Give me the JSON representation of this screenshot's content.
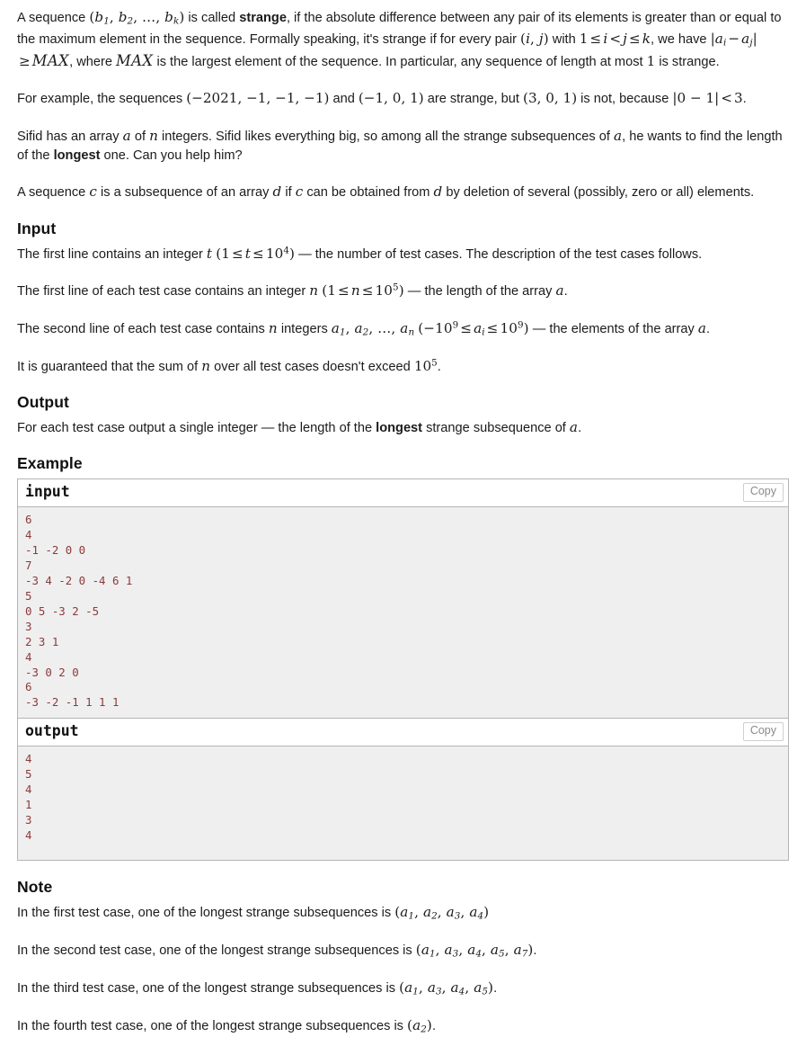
{
  "problem": {
    "definition": {
      "line1_pre": "A sequence ",
      "seq_b": "(b₁, b₂, …, b_k)",
      "line1_mid": " is called ",
      "strange_bold": "strange",
      "line1_post": ", if the absolute difference between any pair of its elements is greater than or equal to the maximum element in the sequence. Formally speaking, it's strange if for every pair ",
      "pair_ij": "(i, j)",
      "with_word": " with ",
      "range_ij": "1 ≤ i < j ≤ k",
      "we_have": ", we have ",
      "abs_diff": "|aᵢ − aⱼ|",
      "geq": " ≥ ",
      "max_sym": "MAX",
      "where_word": ", where ",
      "max_sym2": "MAX",
      "tail": " is the largest element of the sequence. In particular, any sequence of length at most ",
      "one": "1",
      "tail2": " is strange."
    },
    "example_para": {
      "pre": "For example, the sequences ",
      "seq1": "(−2021, −1, −1, −1)",
      "and_word": " and ",
      "seq2": "(−1, 0, 1)",
      "mid": " are strange, but ",
      "seq3": "(3, 0, 1)",
      "post": " is not, because ",
      "ineq": "|0 − 1| < 3",
      "end": "."
    },
    "sifid_para": {
      "pre": "Sifid has an array ",
      "a": "a",
      "mid1": " of ",
      "n": "n",
      "mid2": " integers. Sifid likes everything big, so among all the strange subsequences of ",
      "a2": "a",
      "mid3": ", he wants to find the length of the ",
      "longest_bold": "longest",
      "post": " one. Can you help him?"
    },
    "subsequence_para": {
      "pre": "A sequence ",
      "c": "c",
      "mid1": " is a subsequence of an array ",
      "d": "d",
      "mid2": " if ",
      "c2": "c",
      "mid3": " can be obtained from ",
      "d2": "d",
      "post": " by deletion of several (possibly, zero or all) elements."
    }
  },
  "input_section": {
    "heading": "Input",
    "p1": {
      "pre": "The first line contains an integer ",
      "t": "t",
      "range": "(1 ≤ t ≤ 10⁴)",
      "post": " — the number of test cases. The description of the test cases follows."
    },
    "p2": {
      "pre": "The first line of each test case contains an integer ",
      "n": "n",
      "range": "(1 ≤ n ≤ 10⁵)",
      "post": " — the length of the array ",
      "a": "a",
      "end": "."
    },
    "p3": {
      "pre": "The second line of each test case contains ",
      "n": "n",
      "mid": " integers ",
      "elements": "a₁, a₂, …, a_n",
      "range": "(−10⁹ ≤ aᵢ ≤ 10⁹)",
      "post": " — the elements of the array ",
      "a": "a",
      "end": "."
    },
    "p4": {
      "pre": "It is guaranteed that the sum of ",
      "n": "n",
      "mid": " over all test cases doesn't exceed ",
      "bound": "10⁵",
      "end": "."
    }
  },
  "output_section": {
    "heading": "Output",
    "p1": {
      "pre": "For each test case output a single integer — the length of the ",
      "longest_bold": "longest",
      "post": " strange subsequence of ",
      "a": "a",
      "end": "."
    }
  },
  "example_section": {
    "heading": "Example",
    "input_label": "input",
    "output_label": "output",
    "copy_label": "Copy",
    "input_data": "6\n4\n-1 -2 0 0\n7\n-3 4 -2 0 -4 6 1\n5\n0 5 -3 2 -5\n3\n2 3 1\n4\n-3 0 2 0\n6\n-3 -2 -1 1 1 1",
    "output_data": "4\n5\n4\n1\n3\n4",
    "test_cases": [
      {
        "n": 4,
        "array": [
          -1,
          -2,
          0,
          0
        ],
        "answer": 4
      },
      {
        "n": 7,
        "array": [
          -3,
          4,
          -2,
          0,
          -4,
          6,
          1
        ],
        "answer": 5
      },
      {
        "n": 5,
        "array": [
          0,
          5,
          -3,
          2,
          -5
        ],
        "answer": 4
      },
      {
        "n": 3,
        "array": [
          2,
          3,
          1
        ],
        "answer": 1
      },
      {
        "n": 4,
        "array": [
          -3,
          0,
          2,
          0
        ],
        "answer": 3
      },
      {
        "n": 6,
        "array": [
          -3,
          -2,
          -1,
          1,
          1,
          1
        ],
        "answer": 4
      }
    ],
    "t": 6
  },
  "note_section": {
    "heading": "Note",
    "notes": [
      {
        "pre": "In the first test case, one of the longest strange subsequences is ",
        "seq": "(a₁, a₂, a₃, a₄)",
        "end": ""
      },
      {
        "pre": "In the second test case, one of the longest strange subsequences is ",
        "seq": "(a₁, a₃, a₄, a₅, a₇)",
        "end": "."
      },
      {
        "pre": "In the third test case, one of the longest strange subsequences is ",
        "seq": "(a₁, a₃, a₄, a₅)",
        "end": "."
      },
      {
        "pre": "In the fourth test case, one of the longest strange subsequences is ",
        "seq": "(a₂)",
        "end": "."
      }
    ]
  },
  "colors": {
    "text": "#1b1b1b",
    "sample_data_text": "#8c3a3a",
    "sample_background": "#efefef",
    "border": "#b5b5b5",
    "copy_button_text": "#8a8a8a"
  }
}
